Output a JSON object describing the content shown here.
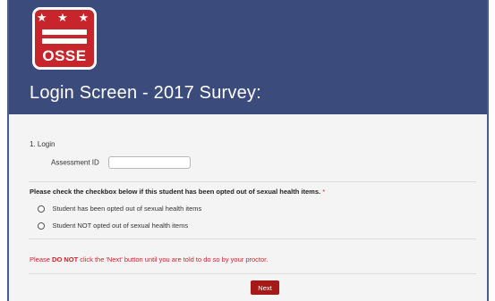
{
  "header": {
    "logo_stars": "★ ★ ★",
    "logo_text": "OSSE",
    "title": "Login Screen - 2017 Survey:",
    "background_color": "#3b4c7c",
    "logo_color": "#c8242b"
  },
  "login": {
    "question_label": "1. Login",
    "assessment_id_label": "Assessment ID",
    "assessment_id_value": ""
  },
  "opt_out": {
    "prompt": "Please check the checkbox below if this student has been opted out of sexual health items.",
    "required_marker": "*",
    "options": [
      {
        "label": "Student has been opted out of sexual health items",
        "selected": false
      },
      {
        "label": "Student NOT opted out of sexual health items",
        "selected": false
      }
    ]
  },
  "warning": {
    "before": "Please ",
    "emphasis": "DO NOT",
    "after": " click the 'Next' button until you are told to do so by your proctor.",
    "color": "#c8242b"
  },
  "next_button": {
    "label": "Next",
    "color": "#a51919"
  }
}
